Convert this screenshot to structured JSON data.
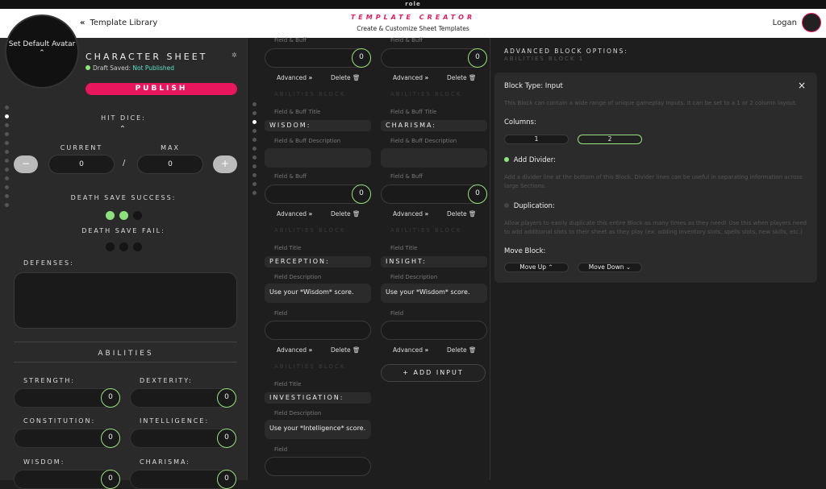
{
  "app": {
    "logo": "role"
  },
  "header": {
    "back_label": "Template Library",
    "title": "TEMPLATE CREATOR",
    "subtitle": "Create & Customize Sheet Templates",
    "user": "Logan"
  },
  "left": {
    "avatar_label": "Set Default Avatar",
    "avatar_chevron": "⌃",
    "sheet_title": "CHARACTER SHEET",
    "draft_prefix": "Draft Saved:",
    "draft_status": "Not Published",
    "publish": "PUBLISH",
    "hit_dice": "HIT DICE:",
    "current": "CURRENT",
    "max": "MAX",
    "current_value": "0",
    "max_value": "0",
    "slash": "/",
    "minus": "−",
    "plus": "+",
    "death_success": "DEATH SAVE SUCCESS:",
    "death_fail": "DEATH SAVE FAIL:",
    "defenses": "DEFENSES:",
    "abilities": "ABILITIES",
    "ability_list": [
      {
        "name": "STRENGTH:",
        "value": "0"
      },
      {
        "name": "DEXTERITY:",
        "value": "0"
      },
      {
        "name": "CONSTITUTION:",
        "value": "0"
      },
      {
        "name": "INTELLIGENCE:",
        "value": "0"
      },
      {
        "name": "WISDOM:",
        "value": "0"
      },
      {
        "name": "CHARISMA:",
        "value": "0"
      }
    ]
  },
  "mid": {
    "field_buff": "Field & Buff",
    "advanced": "Advanced",
    "delete": "Delete",
    "zero": "0",
    "ghost1": "ABILITIES BLOCK",
    "field_buff_title": "Field & Buff Title",
    "field_buff_desc": "Field & Buff Description",
    "wisdom": "WISDOM:",
    "charisma": "CHARISMA:",
    "field_title": "Field Title",
    "field_desc": "Field Description",
    "field": "Field",
    "perception": "PERCEPTION:",
    "insight": "INSIGHT:",
    "use_wisdom": "Use your *Wisdom* score.",
    "investigation": "INVESTIGATION:",
    "use_int": "Use your *Intelligence* score.",
    "add_input": "+ ADD INPUT"
  },
  "right": {
    "heading": "ADVANCED BLOCK OPTIONS:",
    "subheading": "ABILITIES BLOCK 1",
    "block_type": "Block Type: Input",
    "close": "×",
    "block_desc": "This Block can contain a wide range of unique gameplay Inputs. It can be set to a 1 or 2 column layout.",
    "columns": "Columns:",
    "col1": "1",
    "col2": "2",
    "add_divider": "Add Divider:",
    "divider_desc": "Add a divider line at the bottom of this Block. Divider lines can be useful in separating information across large Sections.",
    "duplication": "Duplication:",
    "dup_desc": "Allow players to easily duplicate this entire Block as many times as they need! Use this when players need to add additional slots to their sheet as they play (ex: adding inventory slots, spells slots, new skills, etc.)",
    "move_block": "Move Block:",
    "move_up": "Move Up",
    "move_down": "Move Down"
  }
}
